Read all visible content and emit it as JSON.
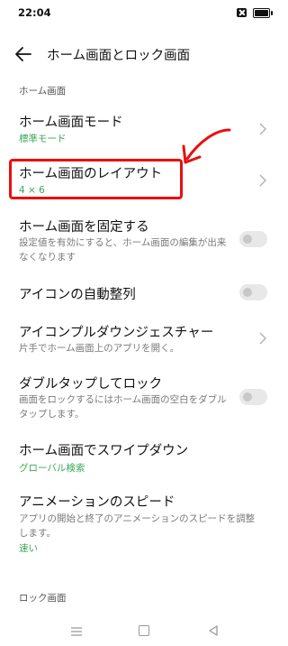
{
  "status_bar": {
    "time": "22:04"
  },
  "header": {
    "title": "ホーム画面とロック画面"
  },
  "sections": {
    "home": "ホーム画面",
    "lock": "ロック画面"
  },
  "rows": {
    "home_mode": {
      "title": "ホーム画面モード",
      "value": "標準モード"
    },
    "layout": {
      "title": "ホーム画面のレイアウト",
      "value": "4 × 6"
    },
    "lock_home": {
      "title": "ホーム画面を固定する",
      "desc": "設定値を有効にすると、ホーム画面の編集が出来なくなります"
    },
    "auto_arrange": {
      "title": "アイコンの自動整列"
    },
    "pulldown_gesture": {
      "title": "アイコンプルダウンジェスチャー",
      "desc": "片手でホーム画面上のアプリを開く。"
    },
    "double_tap_lock": {
      "title": "ダブルタップしてロック",
      "desc": "画面をロックするにはホーム画面の空白をダブルタップします。"
    },
    "swipe_down": {
      "title": "ホーム画面でスワイプダウン",
      "value": "グローバル検索"
    },
    "anim_speed": {
      "title": "アニメーションのスピード",
      "desc": "アプリの開始と終了のアニメーションのスピードを調整します。",
      "value": "速い"
    }
  },
  "colors": {
    "accent_green": "#3aa757",
    "annotation_red": "#e81010"
  }
}
